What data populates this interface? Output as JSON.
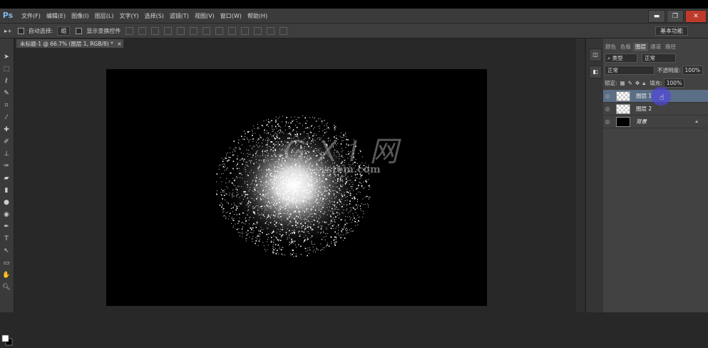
{
  "app": {
    "logo": "Ps"
  },
  "menu": [
    "文件(F)",
    "编辑(E)",
    "图像(I)",
    "图层(L)",
    "文字(Y)",
    "选择(S)",
    "滤镜(T)",
    "视图(V)",
    "窗口(W)",
    "帮助(H)"
  ],
  "window_controls": {
    "minimize": "▬",
    "restore": "❐",
    "close": "✕"
  },
  "options_bar": {
    "tool_glyph": "▸+",
    "auto_select_label": "自动选择:",
    "auto_select_value": "组",
    "show_transform_label": "显示变换控件",
    "workspace": "基本功能"
  },
  "document_tab": {
    "title": "未标题-1 @ 66.7% (图层 1, RGB/8) *",
    "close": "×"
  },
  "watermark": {
    "logo": "G X I 网",
    "url": "system.com"
  },
  "layers_panel": {
    "tabs": [
      "颜色",
      "色板",
      "图层",
      "通道",
      "路径"
    ],
    "active_tab": "图层",
    "filter_kind": "类型",
    "blend_mode": "正常",
    "opacity_label": "不透明度:",
    "opacity_value": "100%",
    "lock_label": "锁定:",
    "fill_label": "填充:",
    "fill_value": "100%",
    "layers": [
      {
        "name": "图层 1",
        "selected": true
      },
      {
        "name": "图层 2",
        "selected": false
      },
      {
        "name": "背景",
        "selected": false
      }
    ]
  }
}
